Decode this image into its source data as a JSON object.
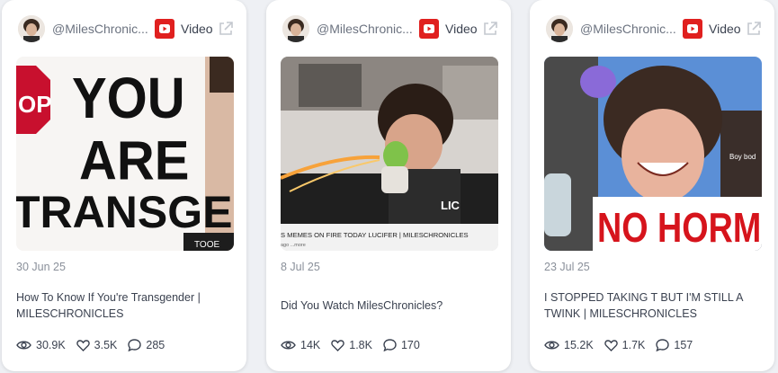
{
  "cards": [
    {
      "handle": "@MilesChronic...",
      "type_label": "Video",
      "thumbnail_text": [
        "YOU",
        "ARE",
        "TRANSGENDE",
        "OP",
        "TOOE"
      ],
      "date": "30 Jun 25",
      "title": "How To Know If You're Transgender | MILESCHRONICLES",
      "views": "30.9K",
      "likes": "3.5K",
      "comments": "285"
    },
    {
      "handle": "@MilesChronic...",
      "type_label": "Video",
      "thumbnail_text": [
        "S MEMES ON FIRE TODAY LUCIFER | MILESCHRONICLES",
        "ago  ...more",
        "LIC"
      ],
      "date": "8 Jul 25",
      "title": "Did You Watch MilesChronicles?",
      "views": "14K",
      "likes": "1.8K",
      "comments": "170"
    },
    {
      "handle": "@MilesChronic...",
      "type_label": "Video",
      "thumbnail_text": [
        "NO HORMO",
        "Boy bod"
      ],
      "date": "23 Jul 25",
      "title": "I STOPPED TAKING T BUT I'M STILL A TWINK | MILESCHRONICLES",
      "views": "15.2K",
      "likes": "1.7K",
      "comments": "157"
    }
  ],
  "colors": {
    "youtube_red": "#e0201f",
    "text_primary": "#3b4250",
    "text_muted": "#8a909a"
  },
  "icons": [
    "avatar",
    "youtube-icon",
    "external-link-icon",
    "eye-icon",
    "heart-icon",
    "comment-icon"
  ]
}
